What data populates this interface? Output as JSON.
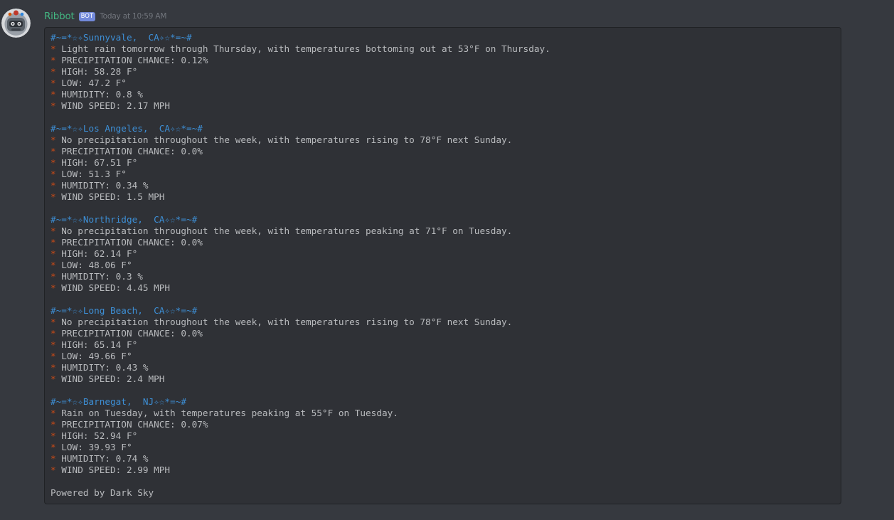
{
  "message": {
    "author": "Ribbot",
    "bot_tag": "BOT",
    "timestamp": "Today at 10:59 AM"
  },
  "forecasts": [
    {
      "heading": "#~=*☆✧Sunnyvale,  CA✧☆*=~#",
      "summary": "Light rain tomorrow through Thursday, with temperatures bottoming out at 53°F on Thursday.",
      "precip": "PRECIPITATION CHANCE: 0.12%",
      "high": "HIGH: 58.28 F°",
      "low": "LOW: 47.2 F°",
      "humidity": "HUMIDITY: 0.8 %",
      "wind": "WIND SPEED: 2.17 MPH"
    },
    {
      "heading": "#~=*☆✧Los Angeles,  CA✧☆*=~#",
      "summary": "No precipitation throughout the week, with temperatures rising to 78°F next Sunday.",
      "precip": "PRECIPITATION CHANCE: 0.0%",
      "high": "HIGH: 67.51 F°",
      "low": "LOW: 51.3 F°",
      "humidity": "HUMIDITY: 0.34 %",
      "wind": "WIND SPEED: 1.5 MPH"
    },
    {
      "heading": "#~=*☆✧Northridge,  CA✧☆*=~#",
      "summary": "No precipitation throughout the week, with temperatures peaking at 71°F on Tuesday.",
      "precip": "PRECIPITATION CHANCE: 0.0%",
      "high": "HIGH: 62.14 F°",
      "low": "LOW: 48.06 F°",
      "humidity": "HUMIDITY: 0.3 %",
      "wind": "WIND SPEED: 4.45 MPH"
    },
    {
      "heading": "#~=*☆✧Long Beach,  CA✧☆*=~#",
      "summary": "No precipitation throughout the week, with temperatures rising to 78°F next Sunday.",
      "precip": "PRECIPITATION CHANCE: 0.0%",
      "high": "HIGH: 65.14 F°",
      "low": "LOW: 49.66 F°",
      "humidity": "HUMIDITY: 0.43 %",
      "wind": "WIND SPEED: 2.4 MPH"
    },
    {
      "heading": "#~=*☆✧Barnegat,  NJ✧☆*=~#",
      "summary": "Rain on Tuesday, with temperatures peaking at 55°F on Tuesday.",
      "precip": "PRECIPITATION CHANCE: 0.07%",
      "high": "HIGH: 52.94 F°",
      "low": "LOW: 39.93 F°",
      "humidity": "HUMIDITY: 0.74 %",
      "wind": "WIND SPEED: 2.99 MPH"
    }
  ],
  "bullet_char": "*",
  "footer": "Powered by Dark Sky",
  "colors": {
    "background": "#36393f",
    "codeblock_bg": "#2f3136",
    "username": "#43b581",
    "bot_tag": "#7289da",
    "heading": "#3d8fd6",
    "bullet": "#cb4b16",
    "text": "#b9bbbe"
  },
  "avatar_icon": "robot-avatar-icon"
}
